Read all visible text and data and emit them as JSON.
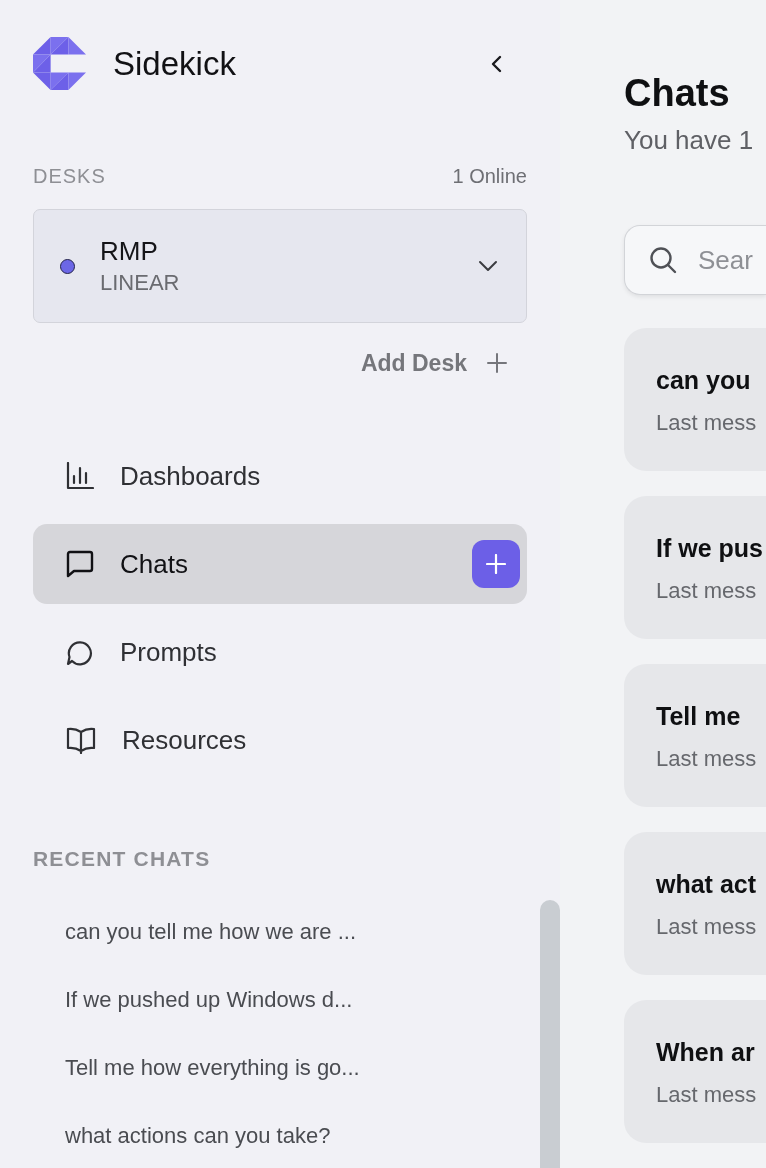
{
  "sidebar": {
    "brand": "Sidekick",
    "desks": {
      "heading": "DESKS",
      "online": "1 Online",
      "items": [
        {
          "name": "RMP",
          "subtitle": "LINEAR",
          "color": "#6c67e6"
        }
      ],
      "add_label": "Add Desk"
    },
    "nav": [
      {
        "label": "Dashboards",
        "selected": false,
        "new_button": false
      },
      {
        "label": "Chats",
        "selected": true,
        "new_button": true
      },
      {
        "label": "Prompts",
        "selected": false,
        "new_button": false
      },
      {
        "label": "Resources",
        "selected": false,
        "new_button": false
      }
    ],
    "recent": {
      "heading": "RECENT CHATS",
      "items": [
        "can you tell me how we are ...",
        "If we pushed up Windows d...",
        "Tell me how everything is go...",
        "what actions can you take?"
      ]
    }
  },
  "main": {
    "title": "Chats",
    "subtitle": "You have 1",
    "search": {
      "placeholder": "Sear"
    },
    "chats": [
      {
        "title": "can you",
        "preview": "Last mess"
      },
      {
        "title": "If we pus",
        "preview": "Last mess"
      },
      {
        "title": "Tell me",
        "preview": "Last mess"
      },
      {
        "title": "what act",
        "preview": "Last mess"
      },
      {
        "title": "When ar",
        "preview": "Last mess"
      }
    ]
  }
}
